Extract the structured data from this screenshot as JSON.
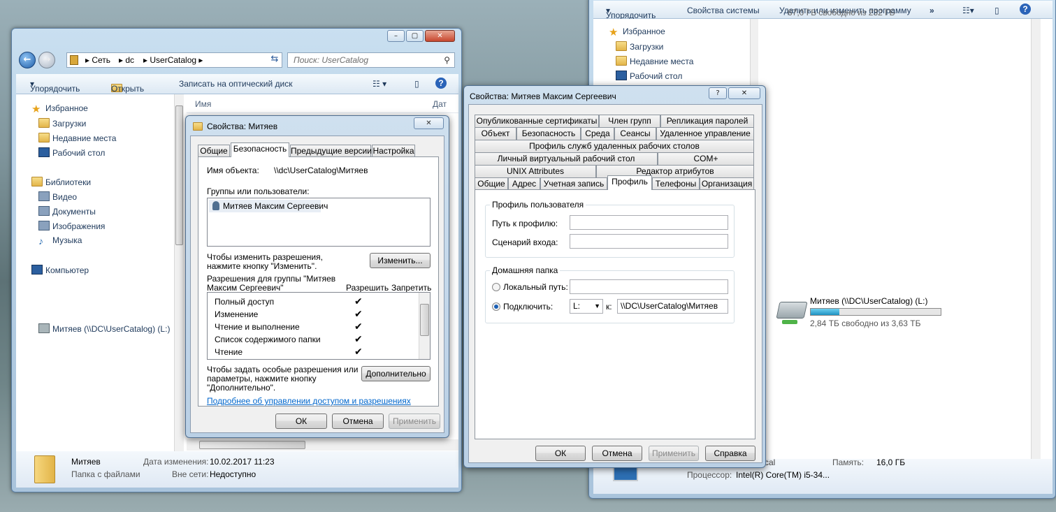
{
  "right_explorer": {
    "cmd": {
      "organize": "Упорядочить",
      "system_props": "Свойства системы",
      "uninstall": "Удалить или изменить программу",
      "more": "»"
    },
    "top_free": "67,0 ГБ свободно из 232 ГБ",
    "nav": [
      "Избранное",
      "Загрузки",
      "Недавние места",
      "Рабочий стол"
    ],
    "drive": {
      "name": "Митяев (\\\\DC\\UserCatalog) (L:)",
      "free": "2,84 ТБ свободно из 3,63 ТБ",
      "used_fraction": 0.22
    },
    "bottom": {
      "workgroup": "cal",
      "mem_label": "Память:",
      "mem_value": "16,0 ГБ",
      "cpu_label": "Процессор:",
      "cpu_value": "Intel(R) Core(TM) i5-34..."
    }
  },
  "left_explorer": {
    "address": [
      "Сеть",
      "dc",
      "UserCatalog"
    ],
    "search_placeholder": "Поиск: UserCatalog",
    "cmd": {
      "organize": "Упорядочить",
      "open": "Открыть",
      "burn": "Записать на оптический диск"
    },
    "col_name": "Имя",
    "col_date": "Дат",
    "nav": {
      "favorites": "Избранное",
      "downloads": "Загрузки",
      "recent": "Недавние места",
      "desktop": "Рабочий стол",
      "libraries": "Библиотеки",
      "video": "Видео",
      "docs": "Документы",
      "images": "Изображения",
      "music": "Музыка",
      "computer": "Компьютер",
      "drive": "Митяев (\\\\DC\\UserCatalog) (L:)"
    },
    "details": {
      "name": "Митяев",
      "type": "Папка с файлами",
      "date_label": "Дата изменения:",
      "date_value": "10.02.2017 11:23",
      "offline_label": "Вне сети:",
      "offline_value": "Недоступно"
    }
  },
  "folder_dialog": {
    "title": "Свойства: Митяев",
    "tabs": [
      "Общие",
      "Безопасность",
      "Предыдущие версии",
      "Настройка"
    ],
    "object_label": "Имя объекта:",
    "object_value": "\\\\dc\\UserCatalog\\Митяев",
    "groups_label": "Группы или пользователи:",
    "user": "Митяев Максим Сергеевич",
    "change_text": "Чтобы изменить разрешения,\nнажмите кнопку \"Изменить\".",
    "change_btn": "Изменить...",
    "perm_label": "Разрешения для группы \"Митяев\nМаксим Сергеевич\"",
    "allow": "Разрешить",
    "deny": "Запретить",
    "perms": [
      "Полный доступ",
      "Изменение",
      "Чтение и выполнение",
      "Список содержимого папки",
      "Чтение"
    ],
    "check": "✔",
    "adv_text": "Чтобы задать особые разрешения или\nпараметры, нажмите кнопку\n\"Дополнительно\".",
    "adv_btn": "Дополнительно",
    "link": "Подробнее об управлении доступом и разрешениях",
    "ok": "ОК",
    "cancel": "Отмена",
    "apply": "Применить"
  },
  "user_dialog": {
    "title": "Свойства: Митяев Максим Сергеевич",
    "help": "?",
    "tabs_row1": [
      "Опубликованные сертификаты",
      "Член групп",
      "Репликация паролей"
    ],
    "tabs_row2": [
      "Объект",
      "Безопасность",
      "Среда",
      "Сеансы",
      "Удаленное управление"
    ],
    "tabs_row3": [
      "Профиль служб удаленных рабочих столов"
    ],
    "tabs_row4": [
      "Личный виртуальный рабочий стол",
      "COM+"
    ],
    "tabs_row5": [
      "UNIX Attributes",
      "Редактор атрибутов"
    ],
    "tabs_row6": [
      "Общие",
      "Адрес",
      "Учетная запись",
      "Профиль",
      "Телефоны",
      "Организация"
    ],
    "profile_group": "Профиль пользователя",
    "profile_path": "Путь к профилю:",
    "logon_script": "Сценарий входа:",
    "home_group": "Домашняя папка",
    "local_path": "Локальный путь:",
    "connect": "Подключить:",
    "drive_letter": "L:",
    "to": "к:",
    "home_path": "\\\\DC\\UserCatalog\\Митяев",
    "ok": "ОК",
    "cancel": "Отмена",
    "apply": "Применить",
    "help_btn": "Справка"
  }
}
